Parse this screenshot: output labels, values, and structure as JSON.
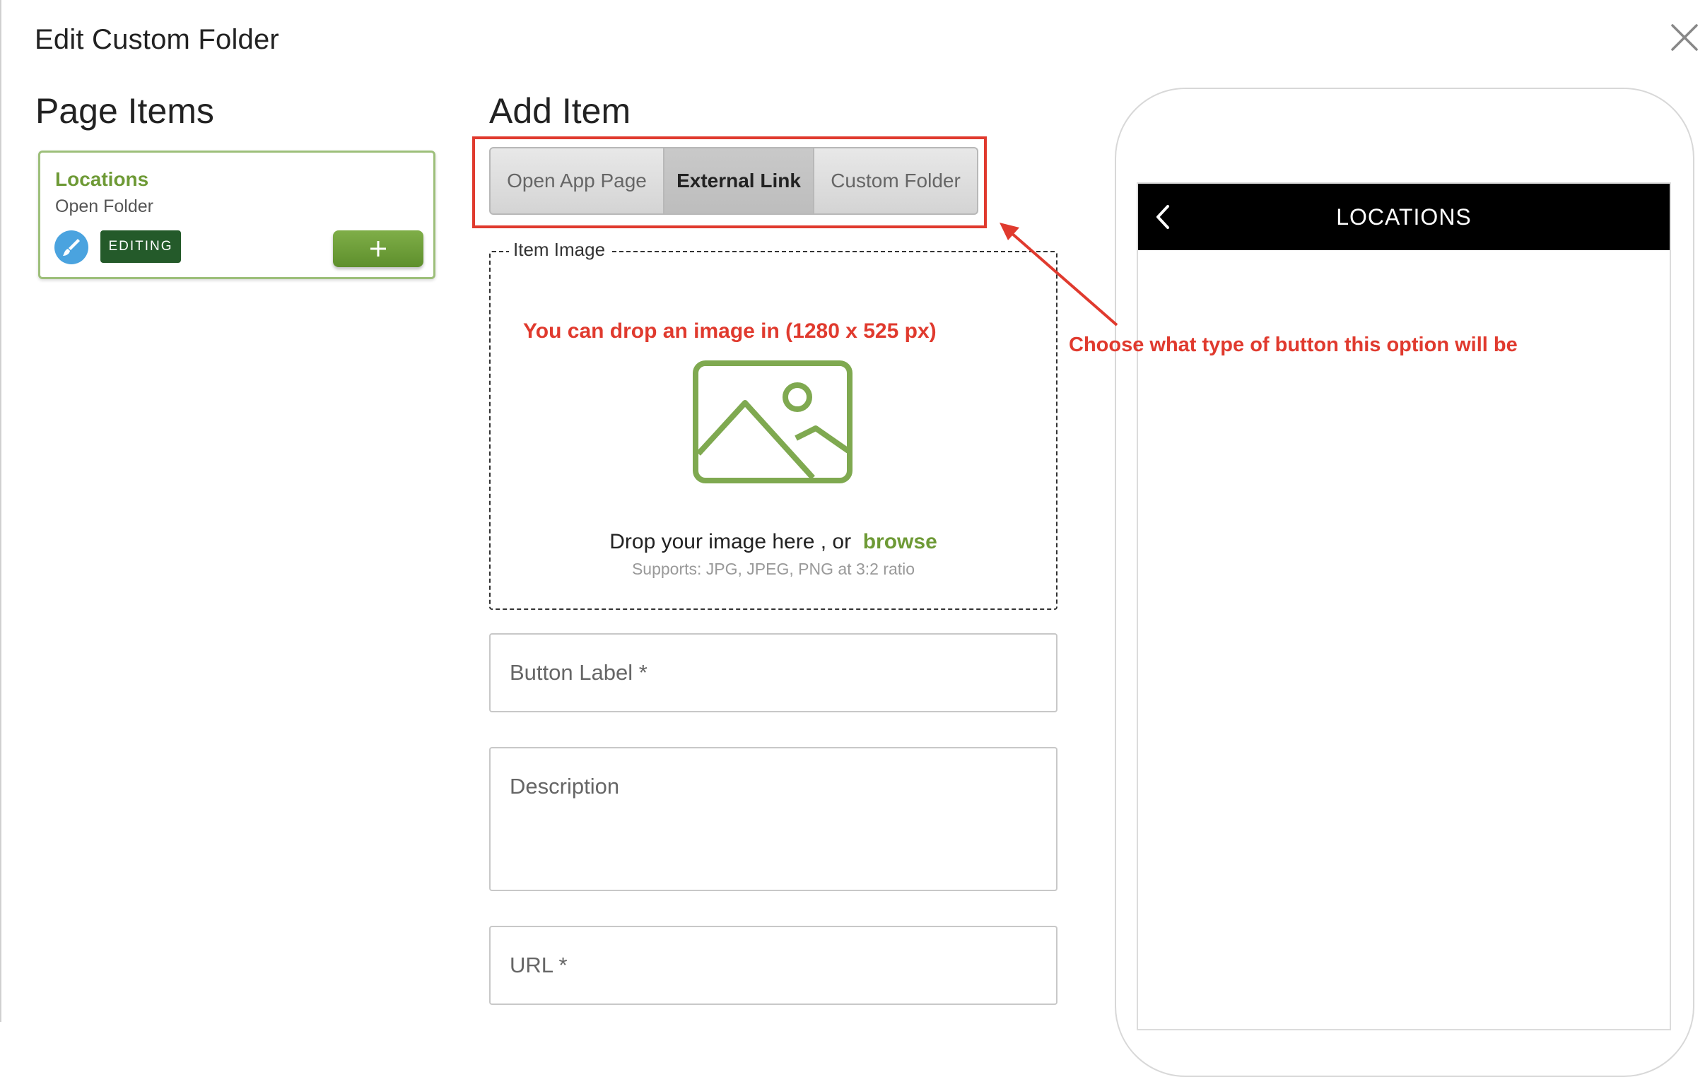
{
  "modal": {
    "title": "Edit Custom Folder"
  },
  "page_items": {
    "title": "Page Items",
    "card": {
      "title": "Locations",
      "subtitle": "Open Folder",
      "badge": "EDITING"
    }
  },
  "add_item": {
    "title": "Add Item",
    "tabs": [
      {
        "label": "Open App Page",
        "active": false
      },
      {
        "label": "External Link",
        "active": true
      },
      {
        "label": "Custom Folder",
        "active": false
      }
    ],
    "dropzone": {
      "legend": "Item Image",
      "hint": "You can drop an image in (1280 x 525 px)",
      "drop_text": "Drop your image here , or",
      "browse": "browse",
      "supports": "Supports: JPG, JPEG, PNG at 3:2 ratio"
    },
    "fields": {
      "button_label": "Button Label *",
      "description": "Description",
      "url": "URL *"
    }
  },
  "annotation": {
    "text": "Choose what type of button this option will be"
  },
  "preview": {
    "header_title": "LOCATIONS"
  },
  "icons": {
    "close": "close-icon",
    "brush": "brush-icon",
    "plus": "plus-icon",
    "image": "image-icon",
    "back": "chevron-left-icon"
  },
  "colors": {
    "brand_green": "#6e9a36",
    "badge_green": "#245a2a",
    "annotation_red": "#e03a2e",
    "edit_blue": "#4aa3df"
  }
}
